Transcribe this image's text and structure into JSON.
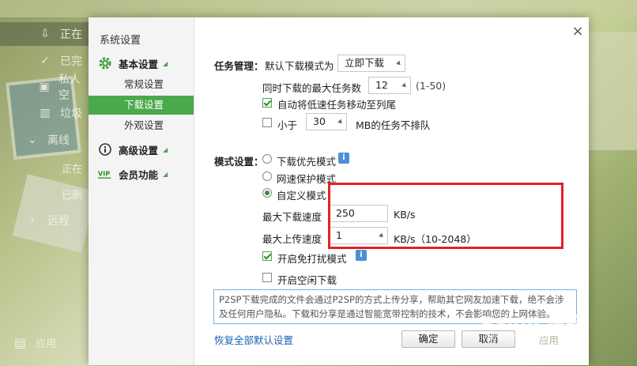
{
  "background_app": {
    "sidebar_items": [
      {
        "icon": "download-arrow-icon",
        "label": "正在"
      },
      {
        "icon": "check-circle-icon",
        "label": "已完"
      },
      {
        "icon": "lock-icon",
        "label": "私人空"
      },
      {
        "icon": "trash-icon",
        "label": "垃圾"
      },
      {
        "icon": "chevron-down-icon",
        "label": "离线"
      },
      {
        "icon": "",
        "label": "正在"
      },
      {
        "icon": "",
        "label": "已删"
      },
      {
        "icon": "chevron-right-icon",
        "label": "远程"
      }
    ],
    "bottom_label": "应用",
    "bottom_right_label": "应用"
  },
  "watermark": {
    "text": "Baidu 经验",
    "sub": "jingyan.baidu.com"
  },
  "dialog": {
    "title": "系统设置",
    "close_label": "×",
    "sections": [
      {
        "icon": "gear-icon",
        "label": "基本设置"
      },
      {
        "icon": "info-circle-icon",
        "label": "高级设置"
      },
      {
        "icon": "vip-icon",
        "label": "会员功能"
      }
    ],
    "sub_items": [
      "常规设置",
      "下载设置",
      "外观设置"
    ],
    "active_sub_item": "下载设置"
  },
  "task_mgmt": {
    "label": "任务管理：",
    "default_mode_label": "默认下载模式为",
    "default_mode_value": "立即下载",
    "max_tasks_label": "同时下载的最大任务数",
    "max_tasks_value": "12",
    "max_tasks_range": "(1-50)",
    "auto_move_label": "自动将低速任务移动至列尾",
    "auto_move_checked": true,
    "less_than_label": "小于",
    "less_than_checked": false,
    "less_than_value": "30",
    "less_than_suffix": "MB的任务不排队"
  },
  "mode": {
    "label": "模式设置：",
    "options": [
      "下载优先模式",
      "网速保护模式",
      "自定义模式"
    ],
    "selected": "自定义模式",
    "max_download_label": "最大下载速度",
    "max_download_value": "250",
    "max_download_unit": "KB/s",
    "max_upload_label": "最大上传速度",
    "max_upload_value": "1",
    "max_upload_unit": "KB/s（10-2048）",
    "no_disturb_label": "开启免打扰模式",
    "no_disturb_checked": true,
    "idle_download_label": "开启空闲下载",
    "idle_download_checked": false
  },
  "notice": {
    "line1": "P2SP下载完成的文件会通过P2SP的方式上传分享，帮助其它网友加速下载，绝不会涉",
    "line2": "及任何用户隐私。下载和分享是通过智能宽带控制的技术，不会影响您的上网体验。"
  },
  "footer": {
    "restore_link": "恢复全部默认设置",
    "ok_label": "确定",
    "cancel_label": "取消"
  },
  "colors": {
    "accent_green": "#4aa94a",
    "highlight_red": "#e2202a",
    "link_blue": "#1a63b5",
    "info_blue": "#4b8fd9"
  }
}
